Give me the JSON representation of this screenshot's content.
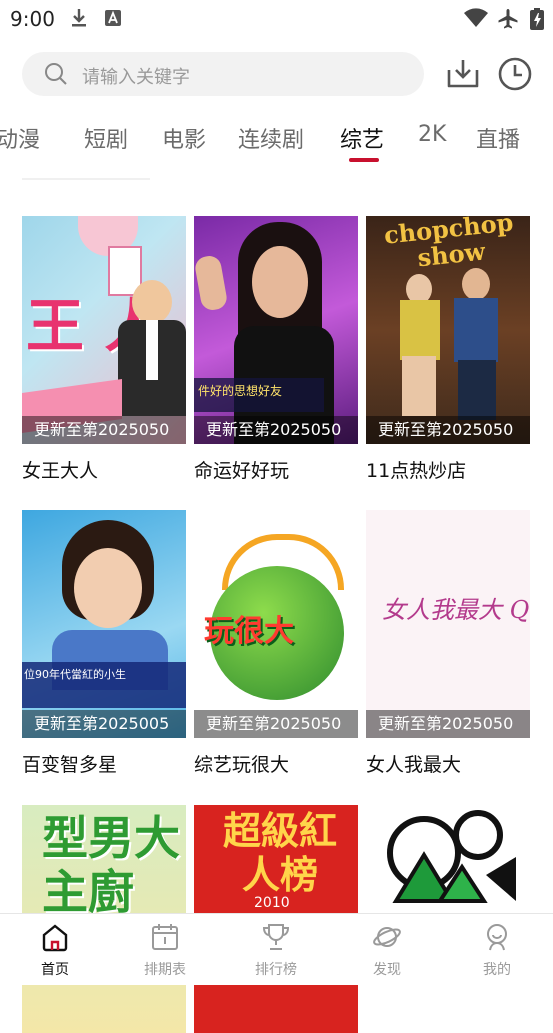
{
  "status_bar": {
    "time": "9:00"
  },
  "search": {
    "placeholder": "请输入关键字"
  },
  "tabs": [
    {
      "label": "动漫"
    },
    {
      "label": "短剧"
    },
    {
      "label": "电影"
    },
    {
      "label": "连续剧"
    },
    {
      "label": "综艺",
      "active": true
    },
    {
      "label": "2K"
    },
    {
      "label": "直播"
    }
  ],
  "grid": [
    {
      "title": "女王大人",
      "update": "更新至第2025050"
    },
    {
      "title": "命运好好玩",
      "update": "更新至第2025050"
    },
    {
      "title": "11点热炒店",
      "update": "更新至第2025050"
    },
    {
      "title": "百变智多星",
      "update": "更新至第2025005"
    },
    {
      "title": "综艺玩很大",
      "update": "更新至第2025050"
    },
    {
      "title": "女人我最大",
      "update": "更新至第2025050"
    },
    {
      "title": "",
      "update": ""
    },
    {
      "title": "",
      "update": ""
    },
    {
      "title": "",
      "update": ""
    }
  ],
  "art_text": {
    "poster1": "王 人",
    "poster2": "件好的思想好友",
    "poster3": "chopchop show",
    "poster4": "位90年代當紅的小生",
    "poster5": "玩很大",
    "poster6": "女人我最大 Queen",
    "poster7": "型男大主廚",
    "poster8": "超級紅人榜",
    "poster8_year": "2010"
  },
  "bottom_nav": [
    {
      "label": "首页",
      "icon": "home-icon",
      "active": true
    },
    {
      "label": "排期表",
      "icon": "calendar-icon"
    },
    {
      "label": "排行榜",
      "icon": "trophy-icon"
    },
    {
      "label": "发现",
      "icon": "planet-icon"
    },
    {
      "label": "我的",
      "icon": "profile-icon"
    }
  ],
  "colors": {
    "accent": "#c8102e",
    "inactive": "#9a9a9a"
  }
}
